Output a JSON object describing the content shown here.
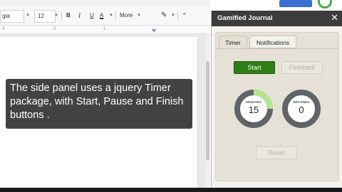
{
  "toolbar": {
    "font_name": "gia",
    "font_size": "12",
    "bold": "B",
    "italic": "I",
    "underline": "U",
    "text_color": "A",
    "more": "More",
    "pen": "✎",
    "collapse": "⌃"
  },
  "ruler": {
    "labels": [
      "3",
      "2",
      "1"
    ]
  },
  "caption": {
    "text": "The side panel uses a jquery Timer package, with Start, Pause and Finish buttons ."
  },
  "panel": {
    "title": "Gamified Journal",
    "close": "✕",
    "tabs": [
      {
        "label": "Timer",
        "active": true
      },
      {
        "label": "Notifications",
        "active": false
      }
    ],
    "start_label": "Start",
    "finished_label": "Finished!",
    "reset_label": "Reset",
    "minutes": {
      "label": "MINUTES",
      "value": "15",
      "fraction": 0.25
    },
    "seconds": {
      "label": "SECONDS",
      "value": "0",
      "fraction": 0
    }
  },
  "colors": {
    "accent_green": "#2f7d16",
    "progress_green": "#b6e58f",
    "dial_ring": "#5f6468",
    "panel_header": "#3c3c3c",
    "share_blue": "#3a6fd6"
  }
}
